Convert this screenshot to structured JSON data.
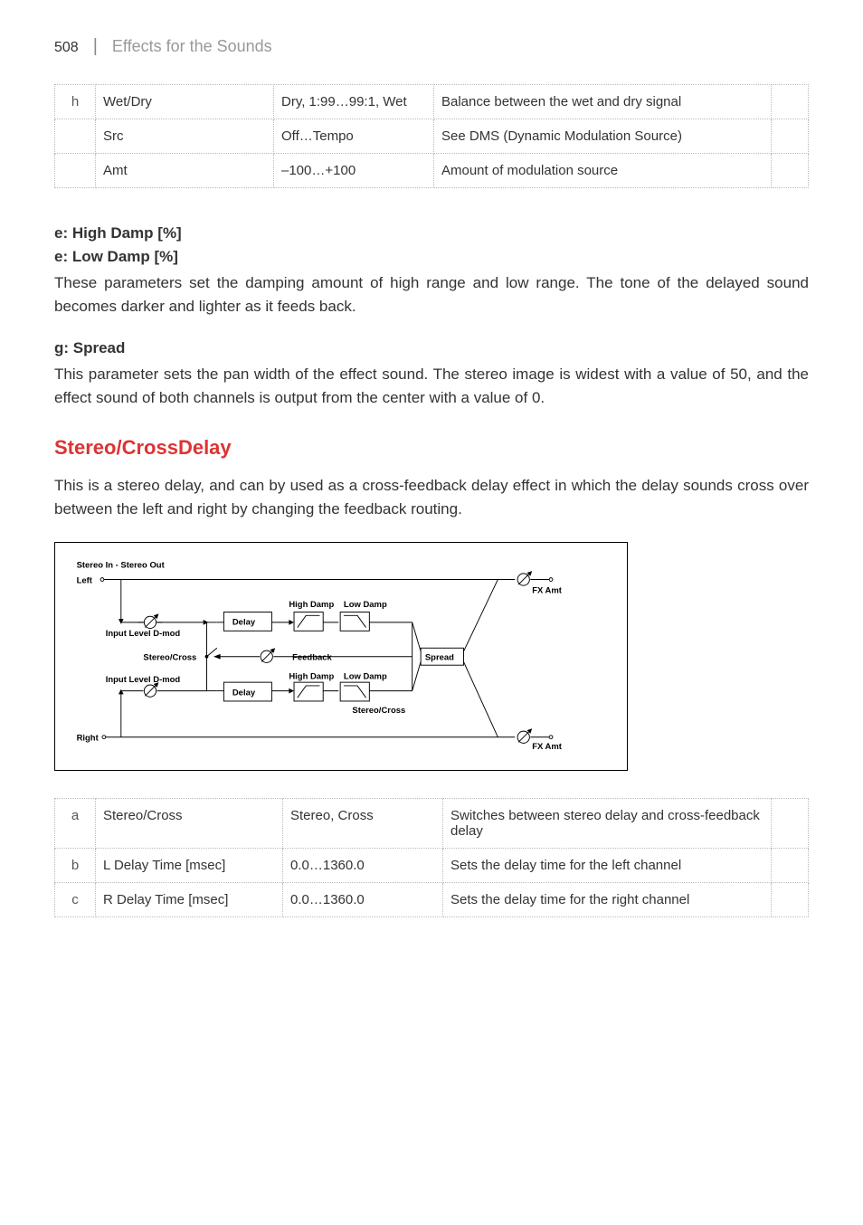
{
  "header": {
    "page": "508",
    "divider": "|",
    "section": "Effects for the Sounds"
  },
  "table1": {
    "rows": [
      {
        "a": "h",
        "b": "Wet/Dry",
        "c": "Dry, 1:99…99:1, Wet",
        "d": "Balance between the wet and dry signal",
        "e": ""
      },
      {
        "a": "",
        "b": "Src",
        "c": "Off…Tempo",
        "d": "See DMS (Dynamic Modulation Source)",
        "e": ""
      },
      {
        "a": "",
        "b": "Amt",
        "c": "–100…+100",
        "d": "Amount of modulation source",
        "e": ""
      }
    ]
  },
  "sec_e": {
    "h1": "e: High Damp [%]",
    "h2": "e: Low Damp [%]",
    "p": "These parameters set the damping amount of high range and low range. The tone of the delayed sound becomes darker and lighter as it feeds back."
  },
  "sec_g": {
    "h": "g: Spread",
    "p": "This parameter sets the pan width of the effect sound. The stereo image is widest with a value of 50, and the effect sound of both channels is output from the center with a value of 0."
  },
  "stereo": {
    "title": "Stereo/CrossDelay",
    "p": "This is a stereo delay, and can by used as a cross-feedback delay effect in which the delay sounds cross over between the left and right by changing the feedback routing."
  },
  "diagram": {
    "title": "Stereo In - Stereo Out",
    "left": "Left",
    "right": "Right",
    "ild": "Input Level D-mod",
    "sc": "Stereo/Cross",
    "delay": "Delay",
    "hd": "High Damp",
    "ld": "Low Damp",
    "fb": "Feedback",
    "spread": "Spread",
    "fxamt": "FX Amt"
  },
  "table2": {
    "rows": [
      {
        "a": "a",
        "b": "Stereo/Cross",
        "c": "Stereo, Cross",
        "d": "Switches between stereo delay and cross-feedback delay",
        "e": ""
      },
      {
        "a": "b",
        "b": "L Delay Time [msec]",
        "c": "0.0…1360.0",
        "d": "Sets the delay time for the left channel",
        "e": ""
      },
      {
        "a": "c",
        "b": "R Delay Time [msec]",
        "c": "0.0…1360.0",
        "d": "Sets the delay time for the right channel",
        "e": ""
      }
    ]
  }
}
